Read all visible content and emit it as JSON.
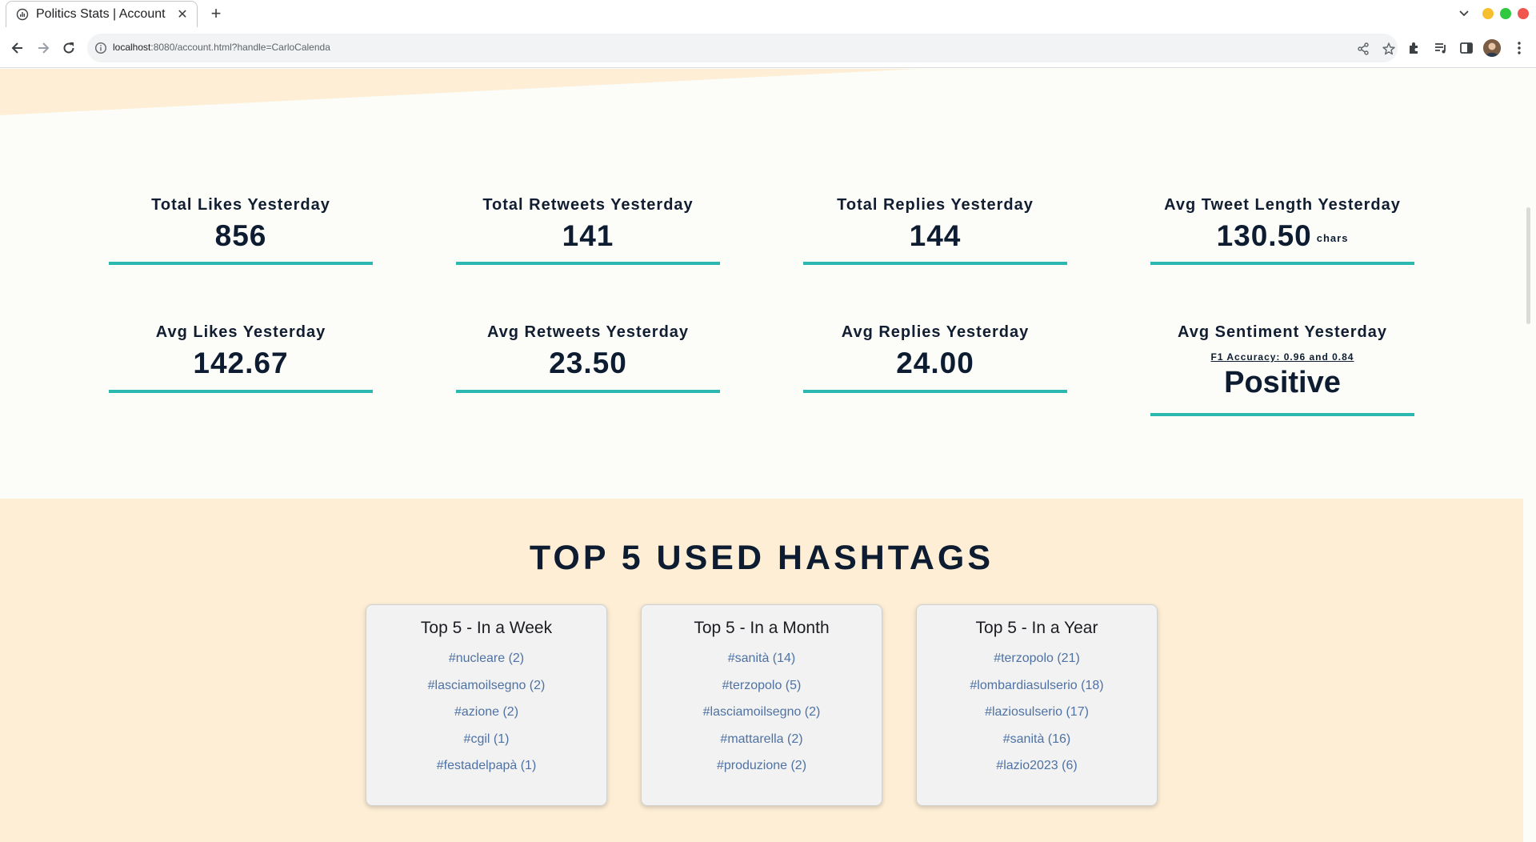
{
  "browser": {
    "tab_title": "Politics Stats | Account",
    "url_host": "localhost",
    "url_rest": ":8080/account.html?handle=CarloCalenda"
  },
  "stats_row1": [
    {
      "label": "Total Likes Yesterday",
      "value": "856"
    },
    {
      "label": "Total Retweets Yesterday",
      "value": "141"
    },
    {
      "label": "Total Replies Yesterday",
      "value": "144"
    },
    {
      "label": "Avg Tweet Length Yesterday",
      "value": "130.50",
      "unit": "chars"
    }
  ],
  "stats_row2": [
    {
      "label": "Avg Likes Yesterday",
      "value": "142.67"
    },
    {
      "label": "Avg Retweets Yesterday",
      "value": "23.50"
    },
    {
      "label": "Avg Replies Yesterday",
      "value": "24.00"
    },
    {
      "label": "Avg Sentiment Yesterday",
      "link": "F1 Accuracy: 0.96 and 0.84",
      "value": "Positive"
    }
  ],
  "hashtags": {
    "title": "TOP 5 USED HASHTAGS",
    "cards": [
      {
        "title": "Top 5 - In a Week",
        "items": [
          "#nucleare (2)",
          "#lasciamoilsegno (2)",
          "#azione (2)",
          "#cgil (1)",
          "#festadelpapà (1)"
        ]
      },
      {
        "title": "Top 5 - In a Month",
        "items": [
          "#sanità (14)",
          "#terzopolo (5)",
          "#lasciamoilsegno (2)",
          "#mattarella (2)",
          "#produzione (2)"
        ]
      },
      {
        "title": "Top 5 - In a Year",
        "items": [
          "#terzopolo (21)",
          "#lombardiasulserio (18)",
          "#laziosulserio (17)",
          "#sanità (16)",
          "#lazio2023 (6)"
        ]
      }
    ]
  },
  "colors": {
    "accent": "#2bb8b0",
    "section_bg": "#fdeed5",
    "link": "#4e72a4",
    "text": "#0d1c30"
  }
}
